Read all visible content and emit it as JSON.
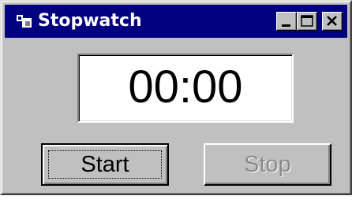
{
  "window": {
    "title": "Stopwatch",
    "icon": "stopwatch-app-icon",
    "controls": {
      "minimize": "minimize-icon",
      "maximize": "maximize-icon",
      "close": "close-icon"
    }
  },
  "display": {
    "time": "00:00"
  },
  "buttons": {
    "start_label": "Start",
    "stop_label": "Stop",
    "stop_enabled": false
  },
  "colors": {
    "titlebar": "#000080",
    "face": "#c0c0c0",
    "disabled_text": "#8a8a8a"
  }
}
